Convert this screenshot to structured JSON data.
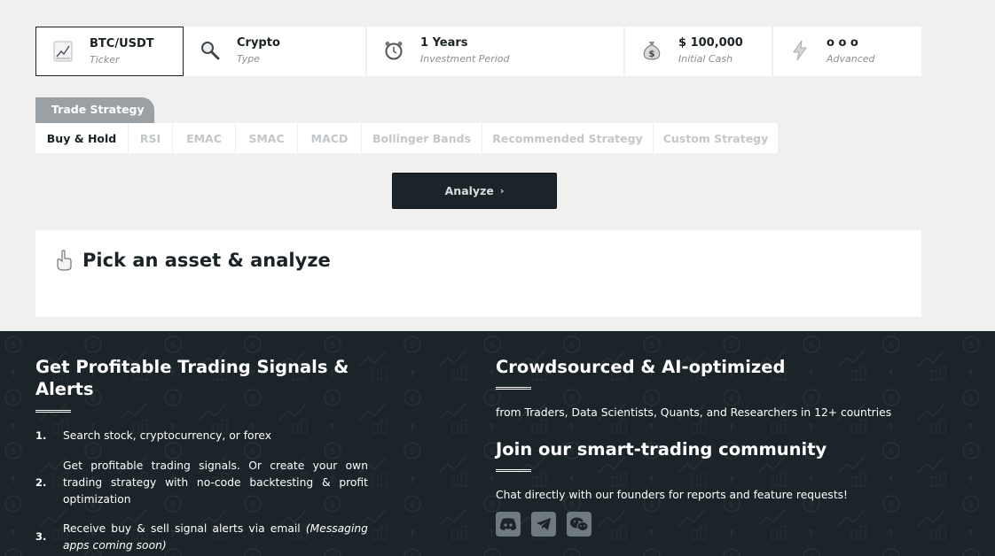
{
  "params": [
    {
      "value": "BTC/USDT",
      "label": "Ticker",
      "icon": "chart-icon"
    },
    {
      "value": "Crypto",
      "label": "Type",
      "icon": "magnifier-icon"
    },
    {
      "value": "1 Years",
      "label": "Investment Period",
      "icon": "alarm-clock-icon"
    },
    {
      "value": "$ 100,000",
      "label": "Initial Cash",
      "icon": "money-bag-icon"
    },
    {
      "value": "o o o",
      "label": "Advanced",
      "icon": "lightning-icon"
    }
  ],
  "strategy": {
    "header": "Trade Strategy",
    "tabs": [
      "Buy & Hold",
      "RSI",
      "EMAC",
      "SMAC",
      "MACD",
      "Bollinger Bands",
      "Recommended Strategy",
      "Custom Strategy"
    ],
    "active_tab": "Buy & Hold"
  },
  "analyze_label": "Analyze",
  "result": {
    "title": "Pick an asset & analyze",
    "icon": "pointing-hand-icon"
  },
  "footer": {
    "left_title": "Get Profitable Trading Signals & Alerts",
    "steps": [
      {
        "num": "1.",
        "text": "Search stock, cryptocurrency, or forex"
      },
      {
        "num": "2.",
        "text": "Get profitable trading signals. Or create your own trading strategy with no-code backtesting & profit optimization"
      },
      {
        "num": "3.",
        "text": "Receive buy & sell signal alerts via email",
        "note": "(Messaging apps coming soon)"
      }
    ],
    "right_title": "Crowdsourced & AI-optimized",
    "right_text": "from Traders, Data Scientists, Quants, and Researchers in 12+ countries",
    "community_title": "Join our smart-trading community",
    "community_text": "Chat directly with our founders for reports and feature requests!",
    "social": [
      "discord-icon",
      "telegram-icon",
      "wechat-icon"
    ]
  },
  "colors": {
    "dark": "#1b2428",
    "muted": "#9aa0a4",
    "background": "#f0f0f0"
  }
}
